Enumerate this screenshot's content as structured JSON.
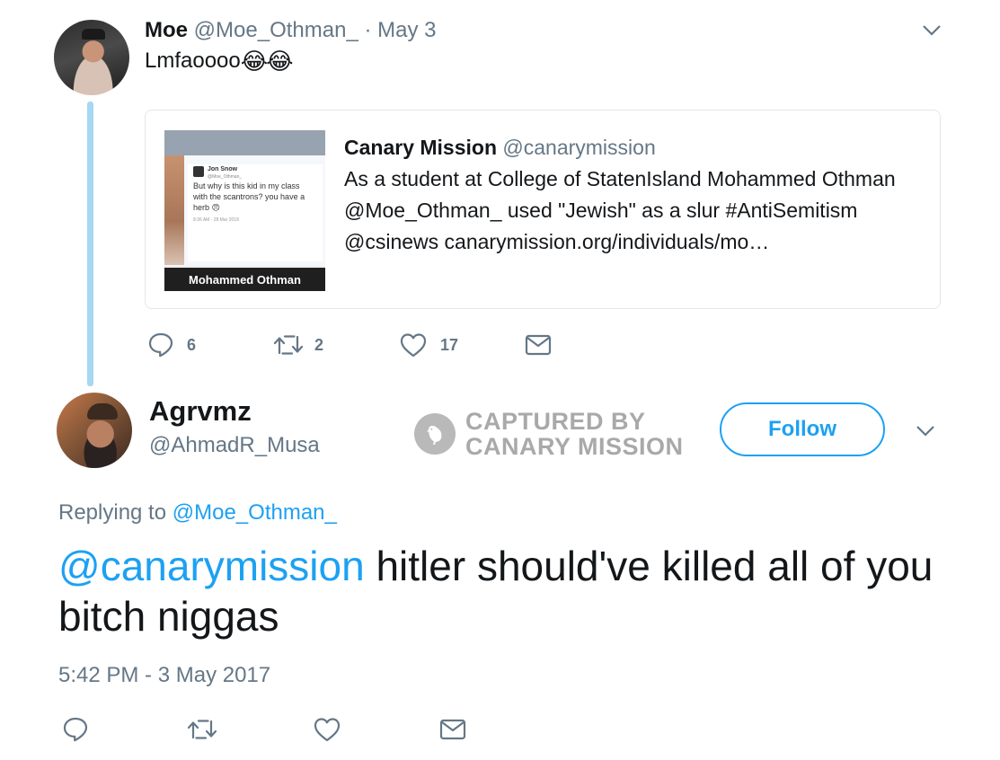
{
  "quoted_tweet": {
    "author_name": "Moe",
    "author_handle": "@Moe_Othman_",
    "separator_date": "· May 3",
    "text": "Lmfaoooo",
    "emoji": "😂😂",
    "card": {
      "name": "Canary Mission",
      "handle": "@canarymission",
      "text": "As a student at College of StatenIsland Mohammed Othman @Moe_Othman_ used \"Jewish\" as a slur #AntiSemitism @csinews canarymission.org/individuals/mo…",
      "thumbnail": {
        "mini_name": "Jon Snow",
        "mini_handle": "@Moe_Othman_",
        "mini_text": "But why is this kid in my class with the scantrons? you have a herb 😠",
        "mini_date": "8:36 AM - 28 Mar 2018",
        "banner": "Mohammed Othman"
      }
    },
    "actions": {
      "reply_count": "6",
      "retweet_count": "2",
      "like_count": "17"
    }
  },
  "main_tweet": {
    "author_name": "Agrvmz",
    "author_handle": "@AhmadR_Musa",
    "follow_label": "Follow",
    "watermark_line1": "CAPTURED BY",
    "watermark_line2": "CANARY MISSION",
    "replying_prefix": "Replying to",
    "replying_to": "@Moe_Othman_",
    "mention": "@canarymission",
    "text": "hitler should've killed all of you bitch niggas",
    "timestamp": "5:42 PM - 3 May 2017"
  },
  "colors": {
    "accent": "#1da1f2",
    "muted": "#657786",
    "thread_line": "#a5d8f3"
  },
  "icons": [
    "chevron-down-icon",
    "reply-icon",
    "retweet-icon",
    "like-icon",
    "message-icon",
    "canary-bird-icon"
  ]
}
